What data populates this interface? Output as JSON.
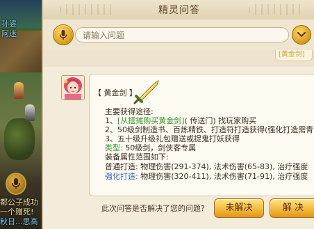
{
  "world": {
    "chat_line_1": "孙婆",
    "chat_line_2": "阿迷",
    "chat_line_3": "都公子成功",
    "chat_line_4": "一个赠死!",
    "chat_line_5": "秋日...思高"
  },
  "dialog": {
    "title": "精灵问答",
    "search": {
      "placeholder": "请输入问题"
    },
    "history_bubble": "[黄金剑]",
    "answer": {
      "heading": "【 黄金剑 】",
      "section_acquire": "主要获得途径:",
      "way1_prefix": "1、",
      "way1_link": "[从摆摊购买黄金剑]",
      "way1_suffix": "( 传送门) 找玩家购买",
      "way2": "2、50级剑制造书、百炼精铁、打造符打造获得(强化打造需青",
      "way3": "3、五十级升级礼包赠送或捉鬼打妖获得",
      "type_label": "类型:",
      "type_value": "50级剑，剑侠客专属",
      "section_attr": "装备属性范围如下:",
      "normal_label": "普通打造:",
      "normal_value": "物理伤害(291-374), 法术伤害(65-83), 治疗强度",
      "strong_label": "强化打造:",
      "strong_value": "物理伤害(320-411), 法术伤害(71-91), 治疗强度"
    },
    "footer": {
      "question": "此次问答是否解决了您的问题?",
      "unsolved_label": "未解决",
      "solved_label": "解 决"
    }
  },
  "colors": {
    "accent_gold": "#f3bb3b",
    "panel_bg": "#f4ecdb",
    "red_text": "#d2352a",
    "green_text": "#3d9a33",
    "blue_text": "#2f63c2"
  },
  "icons": [
    "microphone-icon",
    "chevron-down-icon",
    "sword-icon",
    "avatar-portrait"
  ]
}
